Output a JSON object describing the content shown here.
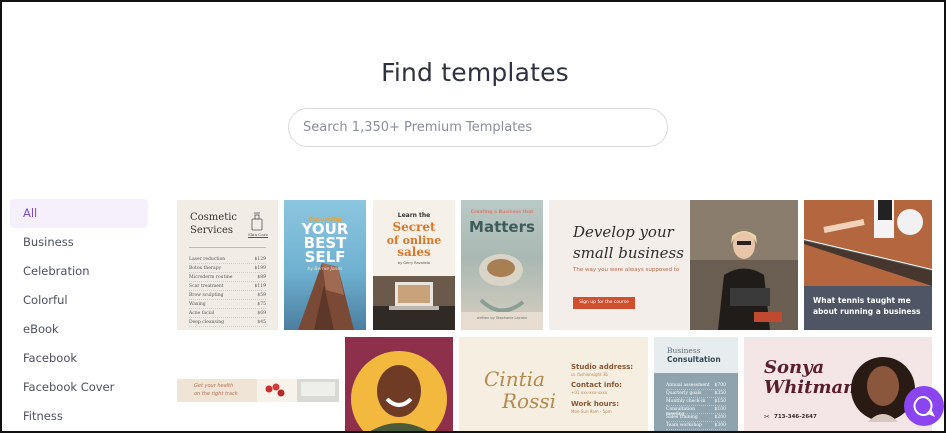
{
  "page": {
    "title": "Find templates"
  },
  "search": {
    "placeholder": "Search 1,350+ Premium Templates",
    "value": ""
  },
  "categories": [
    {
      "label": "All",
      "active": true
    },
    {
      "label": "Business"
    },
    {
      "label": "Celebration"
    },
    {
      "label": "Colorful"
    },
    {
      "label": "eBook"
    },
    {
      "label": "Facebook"
    },
    {
      "label": "Facebook Cover"
    },
    {
      "label": "Fitness"
    }
  ],
  "templates": {
    "cosmetic": {
      "title_line1": "Cosmetic",
      "title_line2": "Services",
      "badge": "Skin Care",
      "items": [
        {
          "name": "Laser reduction",
          "price": "$129"
        },
        {
          "name": "Botox therapy",
          "price": "$199"
        },
        {
          "name": "Microderm routine",
          "price": "$89"
        },
        {
          "name": "Scar treatment",
          "price": "$119"
        },
        {
          "name": "Brow sculpting",
          "price": "$59"
        },
        {
          "name": "Waxing",
          "price": "$75"
        },
        {
          "name": "Acne facial",
          "price": "$69"
        },
        {
          "name": "Deep cleansing",
          "price": "$45"
        }
      ]
    },
    "best_self": {
      "line1": "Becoming",
      "line2": "YOUR",
      "line3": "BEST",
      "line4": "SELF",
      "footer": "by Bernie Jones"
    },
    "online_sales": {
      "line1": "Learn the",
      "line2": "Secret",
      "line3": "of online",
      "line4": "sales",
      "author": "by Gerry Ravalisto"
    },
    "matters": {
      "top": "Creating a Business that",
      "title": "Matters",
      "footer": "written by Stephanie Lacroix"
    },
    "small_business": {
      "line1": "Develop your",
      "line2": "small business",
      "sub": "The way you were always supposed to",
      "cta": "Sign up for the course"
    },
    "tennis": {
      "text": "What tennis taught me about running a business"
    },
    "health": {
      "text_line1": "Get your health",
      "text_line2": "on the right track"
    },
    "cintia": {
      "name_line1": "Cintia",
      "name_line2": "Rossi",
      "addr_label": "Studio address:",
      "addr": "ul. fashionsight 3b",
      "contact_label": "Contact info:",
      "contact": "+01 xxx-xxx-xxxx",
      "hours_label": "Work hours:",
      "hours": "Mon-Sun 9am - 5pm"
    },
    "consultation": {
      "title_line1": "Business",
      "title_line2": "Consultation",
      "rows": [
        {
          "name": "Annual assessment",
          "price": "$700"
        },
        {
          "name": "Quarterly goals",
          "price": "$350"
        },
        {
          "name": "Monthly check-in",
          "price": "$150"
        },
        {
          "name": "Consultation meeting",
          "price": "$100"
        },
        {
          "name": "Sales training",
          "price": "$200"
        },
        {
          "name": "Team workshop",
          "price": "$300"
        }
      ]
    },
    "sonya": {
      "name_line1": "Sonya",
      "name_line2": "Whitman",
      "phone": "713-346-2647"
    }
  },
  "colors": {
    "accent": "#7b4bd3",
    "help": "#8b45f0"
  },
  "icons": {
    "help": "chat-bubble-icon"
  }
}
